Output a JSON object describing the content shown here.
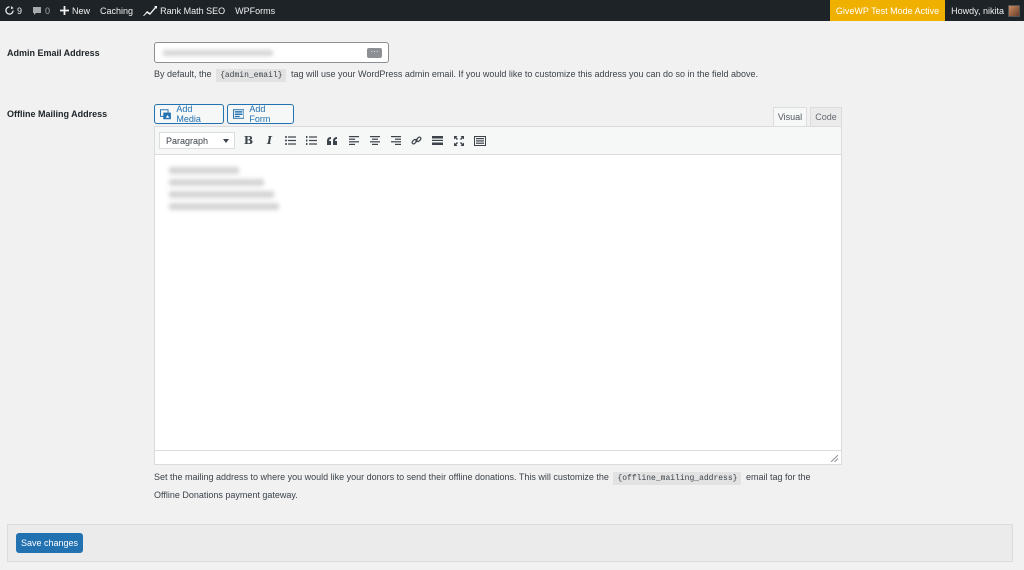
{
  "adminbar": {
    "updates_count": "9",
    "comments_count": "0",
    "new_label": "New",
    "caching_label": "Caching",
    "rankmath_label": "Rank Math SEO",
    "wpforms_label": "WPForms",
    "give_test_mode": "GiveWP Test Mode Active",
    "howdy": "Howdy, nikita",
    "give_color": "#f0b000"
  },
  "fields": {
    "admin_email": {
      "label": "Admin Email Address",
      "desc_before": "By default, the",
      "tag": "{admin_email}",
      "desc_after": "tag will use your WordPress admin email. If you would like to customize this address you can do so in the field above."
    },
    "offline_address": {
      "label": "Offline Mailing Address",
      "add_media": "Add Media",
      "add_form": "Add Form",
      "tab_visual": "Visual",
      "tab_code": "Code",
      "format_select": "Paragraph",
      "desc_line1_before": "Set the mailing address to where you would like your donors to send their offline donations. This will customize the",
      "tag": "{offline_mailing_address}",
      "desc_line1_after": "email tag for the",
      "desc_line2": "Offline Donations payment gateway."
    }
  },
  "save_button": "Save changes",
  "colors": {
    "adminbar_bg": "#1d2327",
    "primary": "#2271b1"
  }
}
